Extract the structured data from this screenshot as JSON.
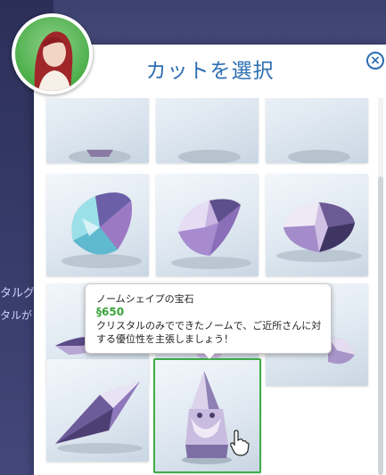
{
  "background": {
    "left_text_1": "タルグ",
    "left_text_2": "タルが"
  },
  "dialog": {
    "title": "カットを選択",
    "close_label": "×"
  },
  "grid": {
    "items": [
      {
        "shape": "top-cut"
      },
      {
        "shape": "top-cut"
      },
      {
        "shape": "top-cut"
      },
      {
        "shape": "teardrop-teal"
      },
      {
        "shape": "teardrop-violet"
      },
      {
        "shape": "round-brilliant"
      },
      {
        "shape": "marquise"
      },
      {
        "shape": "heart"
      },
      {
        "shape": "cushion"
      },
      {
        "shape": "kite"
      },
      {
        "shape": "gnome",
        "selected": true
      }
    ]
  },
  "tooltip": {
    "name": "ノームシェイプの宝石",
    "currency_symbol": "§",
    "price": "650",
    "description": "クリスタルのみでできたノームで、ご近所さんに対する優位性を主張しましょう！"
  },
  "colors": {
    "title": "#2f6fb2",
    "selected_border": "#3fae48",
    "price": "#3aa33c",
    "avatar_bg": "#4caf4a"
  }
}
